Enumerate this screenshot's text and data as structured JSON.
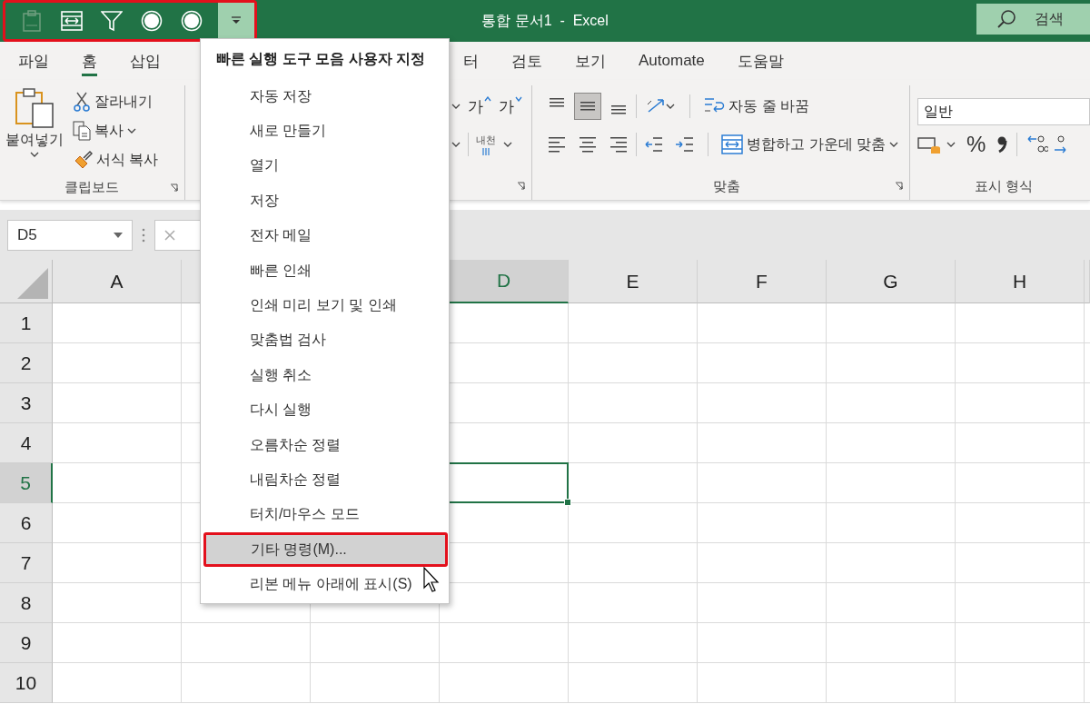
{
  "title_bar": {
    "title": "통합 문서1  -  Excel",
    "search": {
      "placeholder": "검색"
    }
  },
  "quick_access_toolbar": {
    "annotated": true,
    "items": [
      {
        "kind": "paste-values",
        "disabled": true
      },
      {
        "kind": "merge",
        "disabled": false
      },
      {
        "kind": "filter",
        "disabled": false
      },
      {
        "kind": "circle",
        "disabled": false
      },
      {
        "kind": "circle",
        "disabled": false
      }
    ],
    "customize_button": {
      "expanded": true
    }
  },
  "ribbon_tabs": [
    {
      "label": "파일",
      "selected": false
    },
    {
      "label": "홈",
      "selected": true
    },
    {
      "label": "삽입",
      "selected": false
    },
    {
      "label": "터",
      "selected": false
    },
    {
      "label": "검토",
      "selected": false
    },
    {
      "label": "보기",
      "selected": false
    },
    {
      "label": "Automate",
      "selected": false
    },
    {
      "label": "도움말",
      "selected": false
    }
  ],
  "clipboard": {
    "paste": "붙여넣기",
    "cut": "잘라내기",
    "copy": "복사",
    "format_painter": "서식 복사",
    "label": "클립보드"
  },
  "font": {
    "grow": "가",
    "shrink": "가",
    "phonetic": "내천"
  },
  "alignment": {
    "vertical": [
      {
        "kind": "top",
        "selected": false
      },
      {
        "kind": "middle",
        "selected": true
      },
      {
        "kind": "bottom",
        "selected": false
      }
    ],
    "horizontal": [
      {
        "kind": "left",
        "selected": false
      },
      {
        "kind": "center",
        "selected": false
      },
      {
        "kind": "right",
        "selected": false
      }
    ],
    "wrap_text": "자동 줄 바꿈",
    "merge": "병합하고 가운데 맞춤",
    "label": "맞춤"
  },
  "number": {
    "format": "일반",
    "percent": "%",
    "label": "표시 형식"
  },
  "formula_bar": {
    "name_box": "D5"
  },
  "columns": [
    {
      "label": "A",
      "selected": false
    },
    {
      "label": "D",
      "selected": true
    },
    {
      "label": "E",
      "selected": false
    },
    {
      "label": "F",
      "selected": false
    },
    {
      "label": "G",
      "selected": false
    },
    {
      "label": "H",
      "selected": false
    }
  ],
  "rows": [
    {
      "label": "1",
      "selected": false
    },
    {
      "label": "2",
      "selected": false
    },
    {
      "label": "3",
      "selected": false
    },
    {
      "label": "4",
      "selected": false
    },
    {
      "label": "5",
      "selected": true
    },
    {
      "label": "6",
      "selected": false
    },
    {
      "label": "7",
      "selected": false
    },
    {
      "label": "8",
      "selected": false
    },
    {
      "label": "9",
      "selected": false
    },
    {
      "label": "10",
      "selected": false
    }
  ],
  "menu": {
    "title": "빠른 실행 도구 모음 사용자 지정",
    "items": [
      {
        "label": "자동 저장",
        "selected": false,
        "annotated": false
      },
      {
        "label": "새로 만들기",
        "selected": false,
        "annotated": false
      },
      {
        "label": "열기",
        "selected": false,
        "annotated": false
      },
      {
        "label": "저장",
        "selected": false,
        "annotated": false
      },
      {
        "label": "전자 메일",
        "selected": false,
        "annotated": false
      },
      {
        "label": "빠른 인쇄",
        "selected": false,
        "annotated": false
      },
      {
        "label": "인쇄 미리 보기 및 인쇄",
        "selected": false,
        "annotated": false
      },
      {
        "label": "맞춤법 검사",
        "selected": false,
        "annotated": false
      },
      {
        "label": "실행 취소",
        "selected": false,
        "annotated": false
      },
      {
        "label": "다시 실행",
        "selected": false,
        "annotated": false
      },
      {
        "label": "오름차순 정렬",
        "selected": false,
        "annotated": false
      },
      {
        "label": "내림차순 정렬",
        "selected": false,
        "annotated": false
      },
      {
        "label": "터치/마우스 모드",
        "selected": false,
        "annotated": false
      },
      {
        "label": "기타 명령(M)...",
        "selected": true,
        "annotated": true
      },
      {
        "label": "리본 메뉴 아래에 표시(S)",
        "selected": false,
        "annotated": false
      }
    ]
  }
}
